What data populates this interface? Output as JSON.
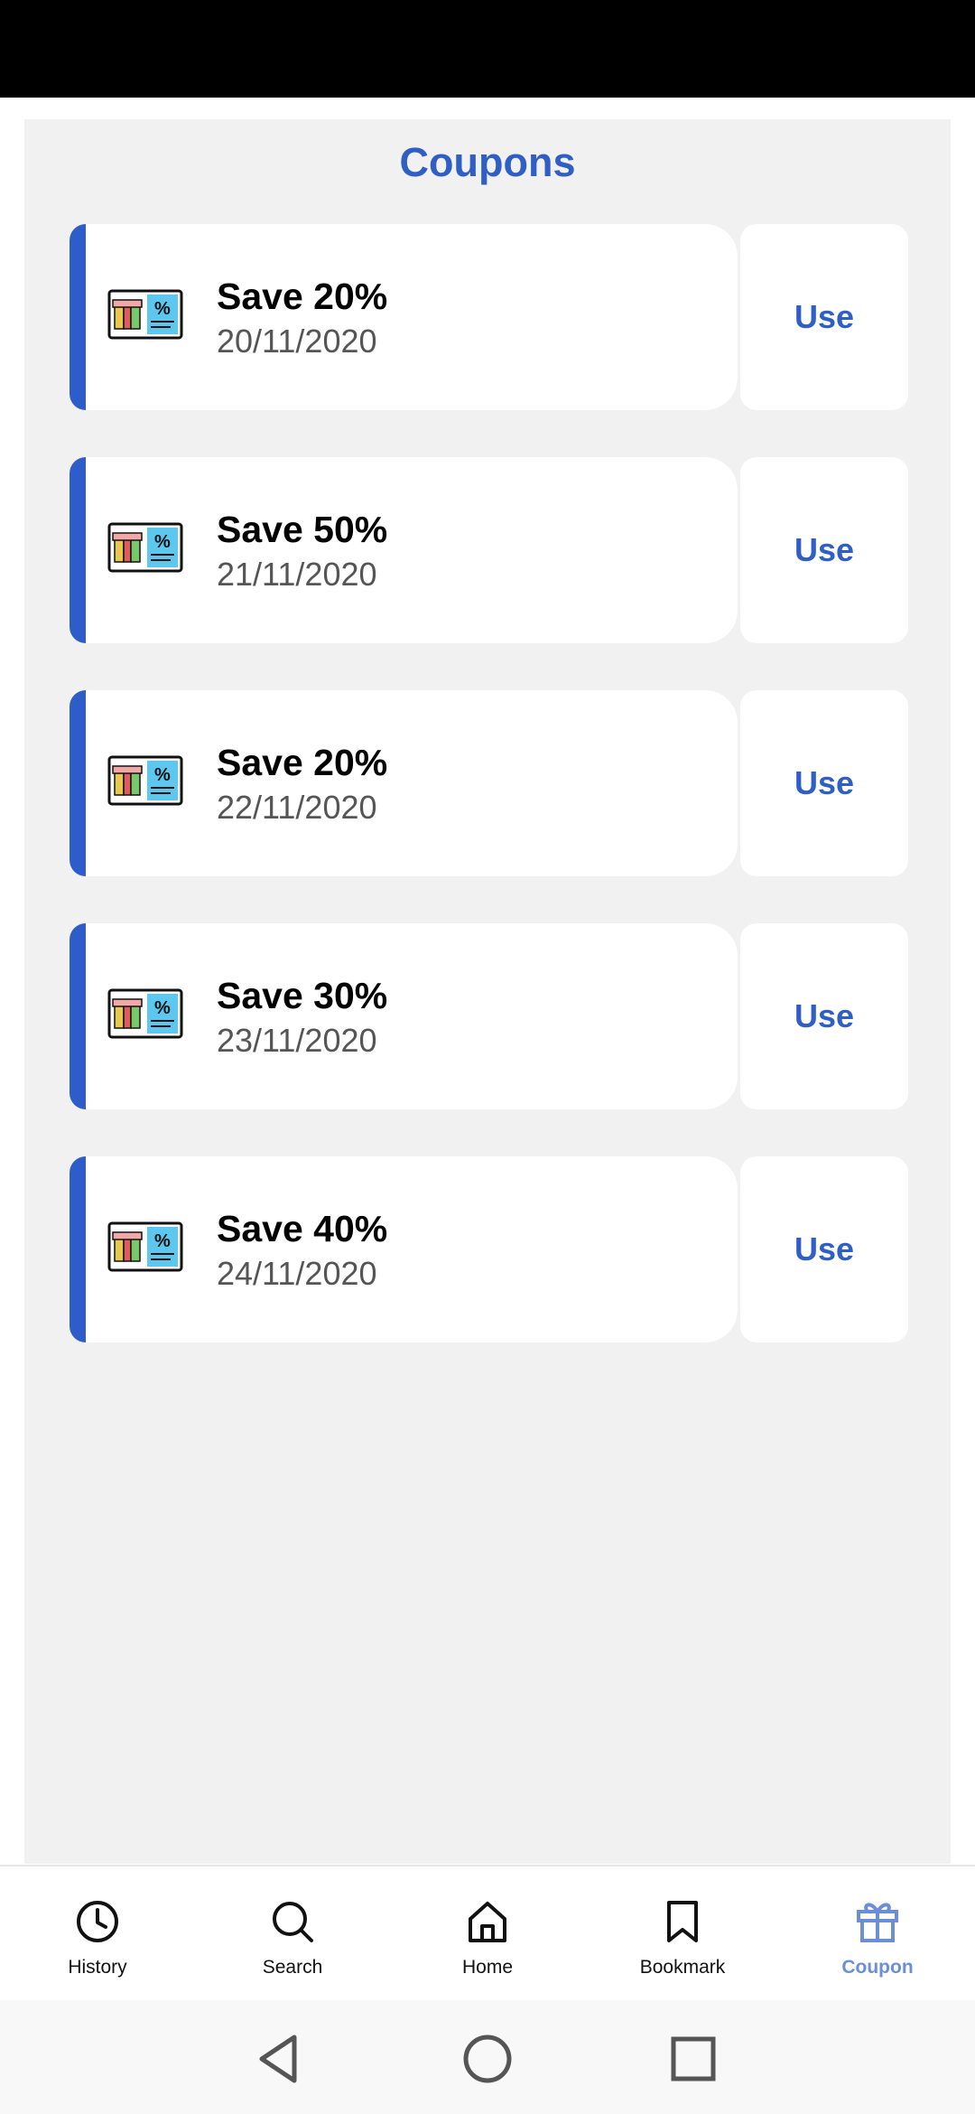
{
  "page": {
    "title": "Coupons"
  },
  "coupons": [
    {
      "title": "Save 20%",
      "date": "20/11/2020",
      "action": "Use"
    },
    {
      "title": "Save 50%",
      "date": "21/11/2020",
      "action": "Use"
    },
    {
      "title": "Save 20%",
      "date": "22/11/2020",
      "action": "Use"
    },
    {
      "title": "Save 30%",
      "date": "23/11/2020",
      "action": "Use"
    },
    {
      "title": "Save 40%",
      "date": "24/11/2020",
      "action": "Use"
    }
  ],
  "bottom_nav": {
    "items": [
      {
        "label": "History",
        "icon": "clock-icon"
      },
      {
        "label": "Search",
        "icon": "search-icon"
      },
      {
        "label": "Home",
        "icon": "home-icon"
      },
      {
        "label": "Bookmark",
        "icon": "bookmark-icon"
      },
      {
        "label": "Coupon",
        "icon": "gift-icon",
        "active": true
      }
    ]
  },
  "colors": {
    "accent": "#2f5ec4",
    "active_nav": "#6b8ed6",
    "background": "#f1f1f1",
    "card": "#ffffff"
  }
}
